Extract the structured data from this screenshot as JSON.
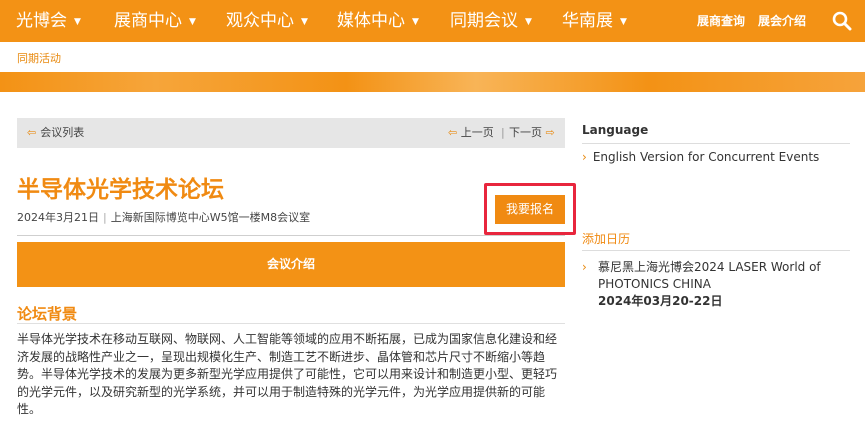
{
  "nav": {
    "items": [
      {
        "label": "光博会"
      },
      {
        "label": "展商中心"
      },
      {
        "label": "观众中心"
      },
      {
        "label": "媒体中心"
      },
      {
        "label": "同期会议"
      },
      {
        "label": "华南展"
      }
    ],
    "right_links": [
      "展商查询",
      "展会介绍"
    ],
    "search_icon": "search-icon"
  },
  "breadcrumb": "同期活动",
  "event_nav": {
    "back_label": "会议列表",
    "prev_label": "上一页",
    "next_label": "下一页"
  },
  "event": {
    "title": "半导体光学技术论坛",
    "date": "2024年3月21日",
    "location": "上海新国际博览中心W5馆一楼M8会议室",
    "register_label": "我要报名",
    "intro_tab": "会议介绍",
    "section_heading": "论坛背景",
    "section_text": "半导体光学技术在移动互联网、物联网、人工智能等领域的应用不断拓展，已成为国家信息化建设和经济发展的战略性产业之一，呈现出规模化生产、制造工艺不断进步、晶体管和芯片尺寸不断缩小等趋势。半导体光学技术的发展为更多新型光学应用提供了可能性，它可以用来设计和制造更小型、更轻巧的光学元件，以及研究新型的光学系统，并可以用于制造特殊的光学元件，为光学应用提供新的可能性。"
  },
  "sidebar": {
    "language_heading": "Language",
    "language_link": "English Version for Concurrent Events",
    "calendar_heading": "添加日历",
    "calendar_event": "慕尼黑上海光博会2024 LASER World of PHOTONICS CHINA",
    "calendar_date": "2024年03月20-22日"
  },
  "colors": {
    "brand_orange": "#f39215",
    "title_orange": "#f08a12",
    "highlight_red": "#e8263d"
  }
}
